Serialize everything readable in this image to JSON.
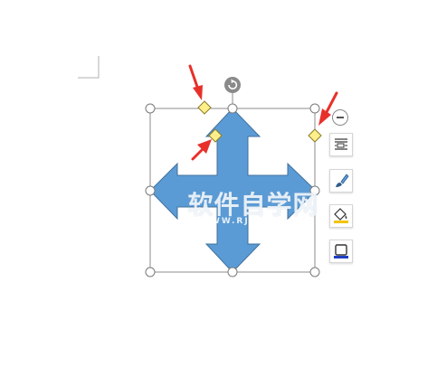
{
  "watermark": {
    "chinese": "软件自学网",
    "url": "WWW.RJZXW.COM"
  },
  "shape": {
    "fill_color": "#5b9bd5",
    "stroke_color": "#41719c"
  },
  "colors": {
    "adjust_handle": "#ffef8a",
    "annotation_arrow": "#e8302a",
    "selection_border": "#8c8c8c",
    "rotate_handle": "#8a8a8a"
  },
  "sidebar": {
    "collapse_icon": "minus-circle-icon",
    "tools": [
      {
        "name": "layout-options",
        "icon": "text-wrap-icon"
      },
      {
        "name": "shape-style",
        "icon": "brush-icon"
      },
      {
        "name": "shape-fill",
        "icon": "paint-bucket-icon"
      },
      {
        "name": "shape-outline",
        "icon": "outline-square-icon"
      }
    ]
  }
}
